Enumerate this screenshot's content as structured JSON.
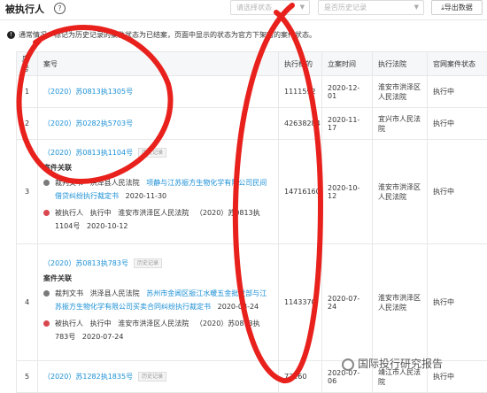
{
  "header": {
    "title": "被执行人",
    "help_icon": "question-circle-icon",
    "status_placeholder": "请选择状态",
    "history_placeholder": "是否历史记录",
    "export_label": "导出数据"
  },
  "notice": "通常情况，标记为历史记录的案件状态为已结案，页面中显示的状态为官方下架时的案件状态。",
  "table": {
    "headers": [
      "序号",
      "案号",
      "执行标的",
      "立案时间",
      "执行法院",
      "官网案件状态"
    ],
    "assoc_title": "案件关联",
    "history_badge": "历史记录",
    "rows": [
      {
        "index": "1",
        "case_no": "（2020）苏0813执1305号",
        "history": false,
        "amount": "1111592",
        "date": "2020-12-01",
        "court": "淮安市洪泽区人民法院",
        "status": "执行中"
      },
      {
        "index": "2",
        "case_no": "（2020）苏0282执5703号",
        "history": false,
        "amount": "42638284",
        "date": "2020-11-17",
        "court": "宜兴市人民法院",
        "status": "执行中"
      },
      {
        "index": "3",
        "case_no": "（2020）苏0813执1104号",
        "history": true,
        "amount": "14716160",
        "date": "2020-10-12",
        "court": "淮安市洪泽区人民法院",
        "status": "执行中",
        "assoc": [
          {
            "color": "#7a7a7a",
            "type": "裁判文书",
            "court": "洪泽县人民法院",
            "link": "项静与江苏振方生物化学有限公司民间借贷纠纷执行裁定书",
            "date": "2020-11-30"
          },
          {
            "color": "#d9474f",
            "type": "被执行人",
            "status": "执行中",
            "court": "淮安市洪泽区人民法院",
            "case_ref": "（2020）苏0813执1104号",
            "date": "2020-10-12"
          }
        ]
      },
      {
        "index": "4",
        "case_no": "（2020）苏0813执783号",
        "history": true,
        "amount": "1143370",
        "date": "2020-07-24",
        "court": "淮安市洪泽区人民法院",
        "status": "执行中",
        "assoc": [
          {
            "color": "#7a7a7a",
            "type": "裁判文书",
            "court": "洪泽县人民法院",
            "link": "苏州市金阊区振江水暖五金批发部与江苏振方生物化学有限公司买卖合同纠纷执行裁定书",
            "date": "2020-08-24"
          },
          {
            "color": "#d9474f",
            "type": "被执行人",
            "status": "执行中",
            "court": "淮安市洪泽区人民法院",
            "case_ref": "（2020）苏0813执783号",
            "date": "2020-07-24"
          }
        ]
      },
      {
        "index": "5",
        "case_no": "（2020）苏1282执1835号",
        "history": true,
        "amount": "72160",
        "date": "2020-07-06",
        "court": "靖江市人民法院",
        "status": "执行中"
      }
    ]
  },
  "watermark": {
    "text": "国际投行研究报告",
    "logo_icon": "circle-logo-icon"
  },
  "annotation_color": "#e8211d"
}
